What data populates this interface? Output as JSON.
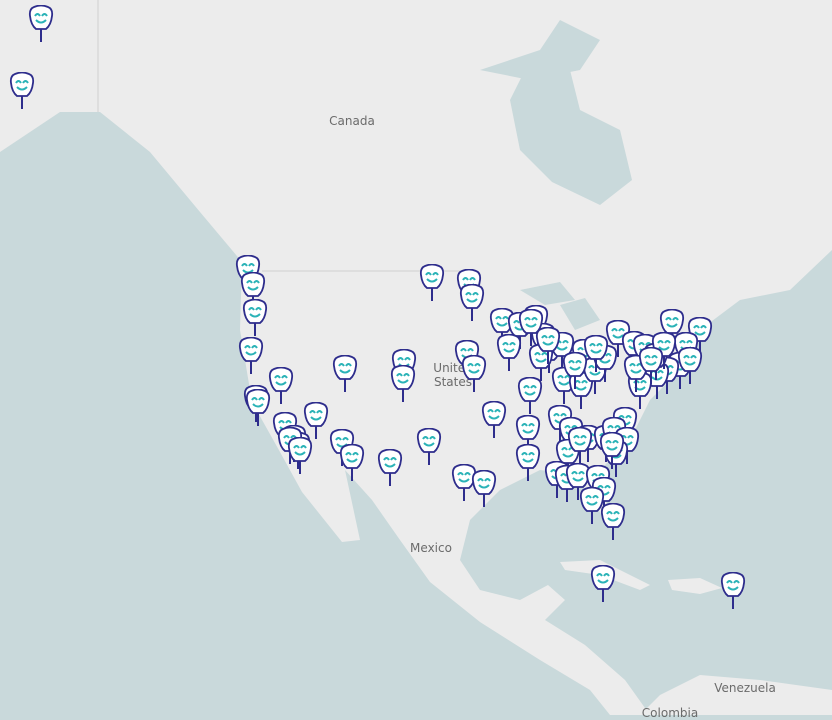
{
  "map": {
    "labels": {
      "canada": "Canada",
      "united_states": "United States",
      "mexico": "Mexico",
      "venezuela": "Venezuela",
      "colombia": "Colombia"
    },
    "marker_icon": "smiley-pin-icon",
    "colors": {
      "water": "#c9d9db",
      "land": "#ececec",
      "marker_border": "#2e2d8c",
      "marker_face": "#2bb3b7"
    }
  }
}
